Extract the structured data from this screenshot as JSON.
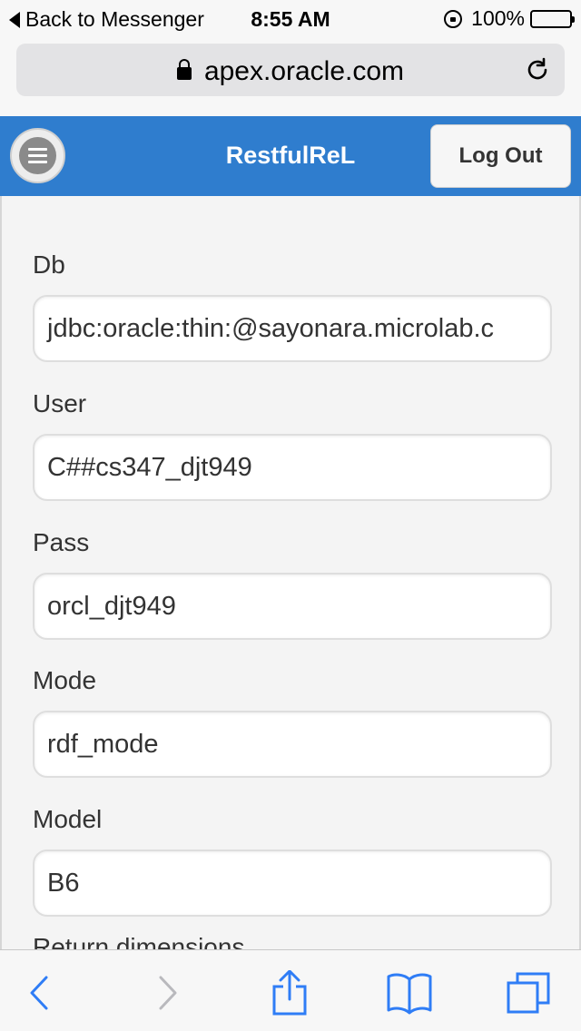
{
  "status_bar": {
    "back_label": "Back to Messenger",
    "time": "8:55 AM",
    "battery": "100%"
  },
  "browser": {
    "url": "apex.oracle.com"
  },
  "app": {
    "title": "RestfulReL",
    "logout_label": "Log Out",
    "accent_color": "#2f7dce"
  },
  "form": {
    "fields": [
      {
        "label": "Db",
        "value": "jdbc:oracle:thin:@sayonara.microlab.c"
      },
      {
        "label": "User",
        "value": "C##cs347_djt949"
      },
      {
        "label": "Pass",
        "value": "orcl_djt949"
      },
      {
        "label": "Mode",
        "value": "rdf_mode"
      },
      {
        "label": "Model",
        "value": "B6"
      }
    ],
    "partial_label": "Return dimensions"
  },
  "toolbar": {
    "icons": [
      "back-icon",
      "forward-icon",
      "share-icon",
      "bookmarks-icon",
      "tabs-icon"
    ]
  }
}
